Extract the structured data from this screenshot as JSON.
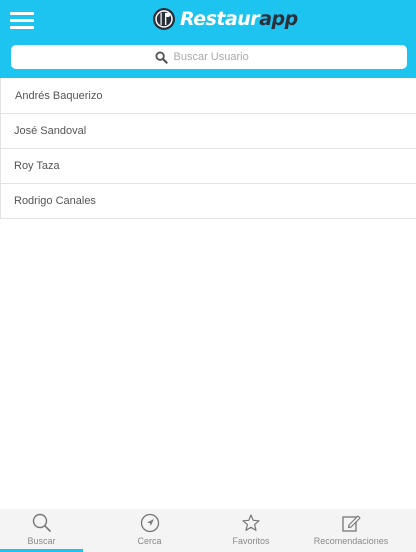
{
  "header": {
    "logo_text_main": "Restaur",
    "logo_text_accent": "app",
    "brand_color": "#1ec4f0"
  },
  "search": {
    "placeholder": "Buscar Usuario",
    "icon": "search-icon"
  },
  "users": [
    {
      "name": "Andrés Baquerizo"
    },
    {
      "name": "José Sandoval"
    },
    {
      "name": "Roy Taza"
    },
    {
      "name": "Rodrigo Canales"
    }
  ],
  "tabs": [
    {
      "label": "Buscar",
      "icon": "search-icon",
      "active": true
    },
    {
      "label": "Cerca",
      "icon": "navigation-arrow-icon",
      "active": false
    },
    {
      "label": "Favoritos",
      "icon": "star-icon",
      "active": false
    },
    {
      "label": "Recomendaciones",
      "icon": "edit-icon",
      "active": false
    }
  ]
}
